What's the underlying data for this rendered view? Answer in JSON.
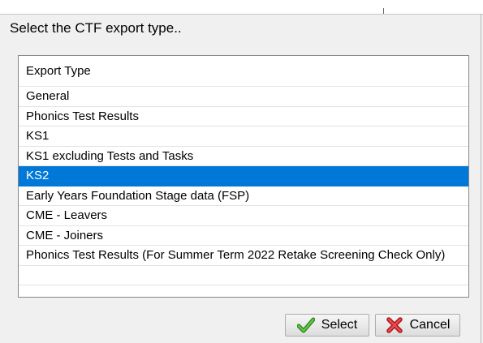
{
  "dialog": {
    "prompt": "Select the CTF export type.."
  },
  "export_list": {
    "header": "Export Type",
    "selected_index": 4,
    "items": [
      "General",
      "Phonics Test Results",
      "KS1",
      "KS1 excluding Tests and Tasks",
      "KS2",
      "Early Years Foundation Stage data (FSP)",
      "CME - Leavers",
      "CME - Joiners",
      "Phonics Test Results (For Summer Term 2022 Retake Screening Check Only)",
      ""
    ]
  },
  "buttons": {
    "select_label": "Select",
    "select_icon": "checkmark-icon",
    "cancel_label": "Cancel",
    "cancel_icon": "red-x-icon"
  },
  "colors": {
    "selection": "#0078d7",
    "checkmark": "#3a9d23",
    "cancel_x": "#d9262c"
  }
}
